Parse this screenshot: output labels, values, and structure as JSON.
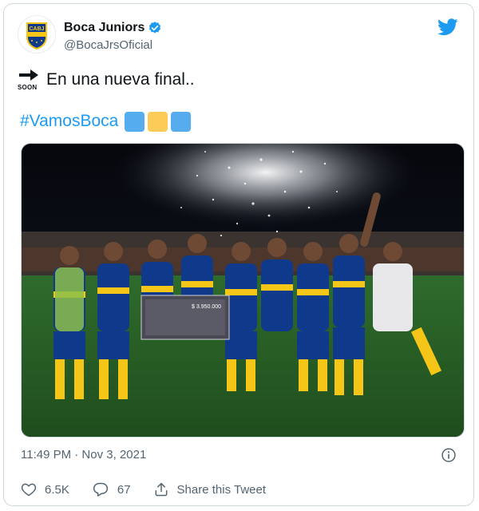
{
  "tweet": {
    "author": {
      "display_name": "Boca Juniors",
      "handle": "@BocaJrsOficial",
      "avatar_icon": "boca-juniors-crest",
      "verified_icon": "verified-badge-icon",
      "crest_text": "CABJ"
    },
    "platform_icon": "twitter-bird-icon",
    "soon_emoji": {
      "icon": "soon-arrow-icon",
      "label": "SOON"
    },
    "text": "En una nueva final..",
    "hashtag": "#VamosBoca",
    "color_squares": [
      "#55acee",
      "#fdcb58",
      "#55acee"
    ],
    "image": {
      "description_icon": "team-celebration-photo",
      "check_amount": "$ 3.950.000"
    },
    "timestamp": "11:49 PM · Nov 3, 2021",
    "info_icon": "info-icon",
    "actions": {
      "like_count": "6.5K",
      "reply_count": "67",
      "share_label": "Share this Tweet"
    },
    "colors": {
      "accent": "#1d9bf0",
      "muted": "#536471",
      "boca_blue": "#0f3a8c",
      "boca_yellow": "#f5c518"
    }
  }
}
